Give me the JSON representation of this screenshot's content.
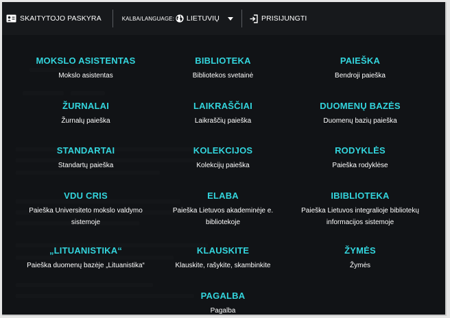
{
  "topbar": {
    "account_label": "SKAITYTOJO PASKYRA",
    "language_prefix": "KALBA/LANGUAGE:",
    "language_value": "LIETUVIŲ",
    "login_label": "PRISIJUNGTI"
  },
  "menu": {
    "moksloasistentas": {
      "title": "MOKSLO ASISTENTAS",
      "desc": "Mokslo asistentas"
    },
    "biblioteka": {
      "title": "BIBLIOTEKA",
      "desc": "Bibliotekos svetainė"
    },
    "paieska": {
      "title": "PAIEŠKA",
      "desc": "Bendroji paieška"
    },
    "zurnalai": {
      "title": "ŽURNALAI",
      "desc": "Žurnalų paieška"
    },
    "laikrasciai": {
      "title": "LAIKRAŠČIAI",
      "desc": "Laikraščių paieška"
    },
    "duomenubazes": {
      "title": "DUOMENŲ BAZĖS",
      "desc": "Duomenų bazių paieška"
    },
    "standartai": {
      "title": "STANDARTAI",
      "desc": "Standartų paieška"
    },
    "kolekcijos": {
      "title": "KOLEKCIJOS",
      "desc": "Kolekcijų paieška"
    },
    "rodykles": {
      "title": "RODYKLĖS",
      "desc": "Paieška rodyklėse"
    },
    "vducris": {
      "title": "VDU CRIS",
      "desc1": "Paieška Universiteto mokslo valdymo",
      "desc2": "sistemoje"
    },
    "elaba": {
      "title": "ELABA",
      "desc1": "Paieška Lietuvos akademinėje e.",
      "desc2": "bibliotekoje"
    },
    "ibiblioteka": {
      "title": "IBIBLIOTEKA",
      "desc1": "Paieška Lietuvos integralioje bibliotekų",
      "desc2": "informacijos sistemoje"
    },
    "lituanistika": {
      "title": "„LITUANISTIKA“",
      "desc": "Paieška duomenų bazėje „Lituanistika“"
    },
    "klauskite": {
      "title": "KLAUSKITE",
      "desc": "Klauskite, rašykite, skambinkite"
    },
    "zymes": {
      "title": "ŽYMĖS",
      "desc": "Žymės"
    },
    "pagalba": {
      "title": "PAGALBA",
      "desc": "Pagalba"
    }
  },
  "colors": {
    "accent": "#33d5dd",
    "topbar_bg": "#17191c",
    "panel_bg": "#2c2f33",
    "text": "#ffffff"
  }
}
